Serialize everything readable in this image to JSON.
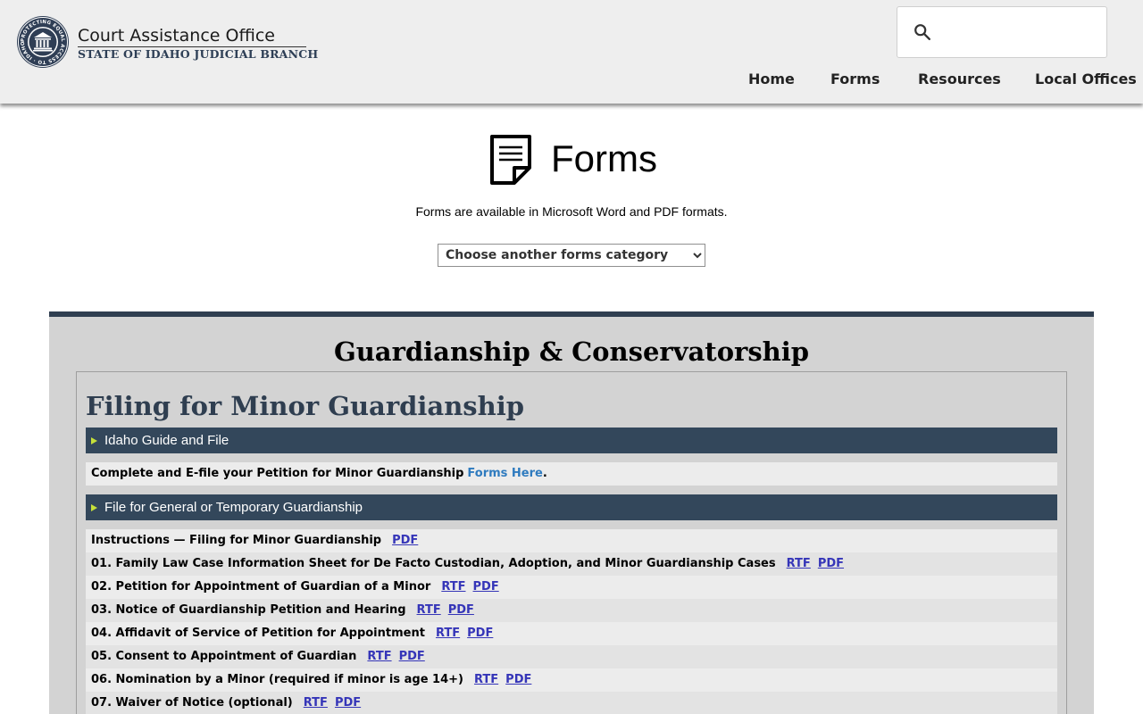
{
  "header": {
    "brand_title": "Court Assistance Office",
    "brand_subtitle": "STATE OF IDAHO JUDICIAL BRANCH",
    "seal_text": "PROTECTING EQUAL ACCESS TO · IDAHO · COURTS",
    "search": {
      "value": "",
      "placeholder": ""
    },
    "nav": [
      {
        "label": "Home"
      },
      {
        "label": "Forms"
      },
      {
        "label": "Resources"
      },
      {
        "label": "Local Offices"
      }
    ]
  },
  "page": {
    "title": "Forms",
    "description": "Forms are available in Microsoft Word and PDF formats.",
    "category_select": {
      "selected": "Choose another forms category"
    }
  },
  "panel": {
    "title": "Guardianship & Conservatorship",
    "section_title": "Filing for Minor Guardianship",
    "bars": [
      {
        "label": "Idaho Guide and File"
      },
      {
        "label": "File for General or Temporary Guardianship"
      }
    ],
    "efile_row": {
      "text": "Complete and E-file your Petition for Minor Guardianship",
      "link": "Forms Here",
      "end": "."
    },
    "forms": [
      {
        "title": "Instructions — Filing for Minor Guardianship",
        "links": [
          "PDF"
        ]
      },
      {
        "title": "01. Family Law Case Information Sheet for De Facto Custodian, Adoption, and Minor Guardianship Cases",
        "links": [
          "RTF",
          "PDF"
        ]
      },
      {
        "title": "02. Petition for Appointment of Guardian of a Minor",
        "links": [
          "RTF",
          "PDF"
        ]
      },
      {
        "title": "03. Notice of Guardianship Petition and Hearing",
        "links": [
          "RTF",
          "PDF"
        ]
      },
      {
        "title": "04. Affidavit of Service of Petition for Appointment",
        "links": [
          "RTF",
          "PDF"
        ]
      },
      {
        "title": "05. Consent to Appointment of Guardian",
        "links": [
          "RTF",
          "PDF"
        ]
      },
      {
        "title": "06. Nomination by a Minor (required if minor is age 14+)",
        "links": [
          "RTF",
          "PDF"
        ]
      },
      {
        "title": "07. Waiver of Notice (optional)",
        "links": [
          "RTF",
          "PDF"
        ]
      }
    ]
  },
  "colors": {
    "header_bg": "#eeeeee",
    "panel_bg": "#d3d3d3",
    "panel_border": "#2f3e50",
    "bar_bg": "#33475b",
    "bar_arrow": "#c6e03a",
    "link": "#3535b8",
    "inline_link": "#2f7bbf"
  },
  "icons": {
    "logo": "court-seal-icon",
    "search": "search-icon",
    "page": "document-icon",
    "bar": "triangle-right-icon"
  }
}
